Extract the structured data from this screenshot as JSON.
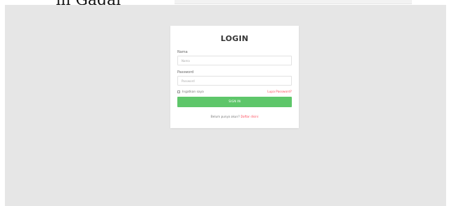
{
  "header": {
    "cut_text": "in Gagal"
  },
  "login": {
    "title": "LOGIN",
    "name_label": "Nama",
    "name_placeholder": "Nama",
    "name_value": "",
    "password_label": "Password",
    "password_placeholder": "Password",
    "password_value": "",
    "remember_label": "Ingatkan saya",
    "remember_checked": false,
    "forgot_label": "Lupa Password?",
    "signin_label": "SIGN IN",
    "register_prompt": "Belum punya akun?",
    "register_link": "Daftar disini"
  },
  "colors": {
    "background": "#e6e6e6",
    "card": "#ffffff",
    "signin_button": "#5ec66a",
    "link": "#ff4b5c"
  }
}
